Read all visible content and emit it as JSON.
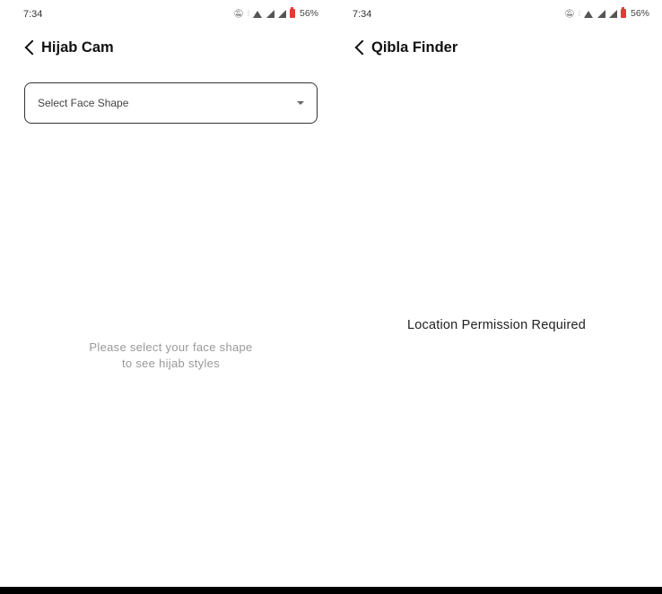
{
  "left_screen": {
    "status_bar": {
      "time": "7:34",
      "battery_percent": "56%",
      "icons": [
        "mute-icon",
        "volte-icon",
        "wifi-icon",
        "signal-icon",
        "signal-icon",
        "battery-icon"
      ]
    },
    "app_bar": {
      "title": "Hijab Cam",
      "back_icon": "chevron-left-icon"
    },
    "face_shape_select": {
      "label": "Select Face Shape",
      "icon": "chevron-down-icon"
    },
    "empty_state": {
      "line1": "Please select your face shape",
      "line2": "to see hijab styles"
    }
  },
  "right_screen": {
    "status_bar": {
      "time": "7:34",
      "battery_percent": "56%",
      "icons": [
        "mute-icon",
        "volte-icon",
        "wifi-icon",
        "signal-icon",
        "signal-icon",
        "battery-icon"
      ]
    },
    "app_bar": {
      "title": "Qibla Finder",
      "back_icon": "chevron-left-icon"
    },
    "message": "Location Permission Required"
  },
  "colors": {
    "battery": "#e53935",
    "decor": "#aeb6e4",
    "nav_bar": "#000000"
  }
}
